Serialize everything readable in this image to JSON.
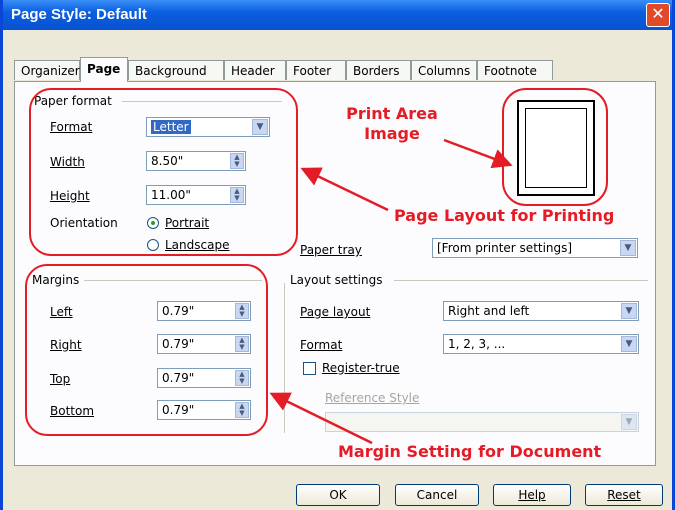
{
  "window": {
    "title": "Page Style: Default",
    "close_glyph": "✕"
  },
  "tabs": [
    "Organizer",
    "Page",
    "Background",
    "Header",
    "Footer",
    "Borders",
    "Columns",
    "Footnote"
  ],
  "paper_format": {
    "heading": "Paper format",
    "format": {
      "label": "Format",
      "value": "Letter"
    },
    "width": {
      "label": "Width",
      "value": "8.50\""
    },
    "height": {
      "label": "Height",
      "value": "11.00\""
    },
    "orientation": {
      "label": "Orientation",
      "options": [
        "Portrait",
        "Landscape"
      ],
      "selected": "Portrait"
    },
    "paper_tray": {
      "label": "Paper tray",
      "value": "[From printer settings]"
    }
  },
  "margins": {
    "heading": "Margins",
    "left": {
      "label": "Left",
      "value": "0.79\""
    },
    "right": {
      "label": "Right",
      "value": "0.79\""
    },
    "top": {
      "label": "Top",
      "value": "0.79\""
    },
    "bottom": {
      "label": "Bottom",
      "value": "0.79\""
    }
  },
  "layout_settings": {
    "heading": "Layout settings",
    "page_layout": {
      "label": "Page layout",
      "value": "Right and left"
    },
    "format": {
      "label": "Format",
      "value": "1, 2, 3, ..."
    },
    "register_true": {
      "label": "Register-true",
      "checked": false
    },
    "reference_style": {
      "label": "Reference Style",
      "value": ""
    }
  },
  "buttons": {
    "ok": "OK",
    "cancel": "Cancel",
    "help": "Help",
    "reset": "Reset"
  },
  "annotations": {
    "print_area_line1": "Print Area",
    "print_area_line2": "Image",
    "page_layout": "Page Layout for Printing",
    "margin_setting": "Margin Setting for Document"
  },
  "colors": {
    "annotation": "#e41c26",
    "titlebar": "#0a5fe0",
    "dialog_bg": "#ece9d8"
  }
}
